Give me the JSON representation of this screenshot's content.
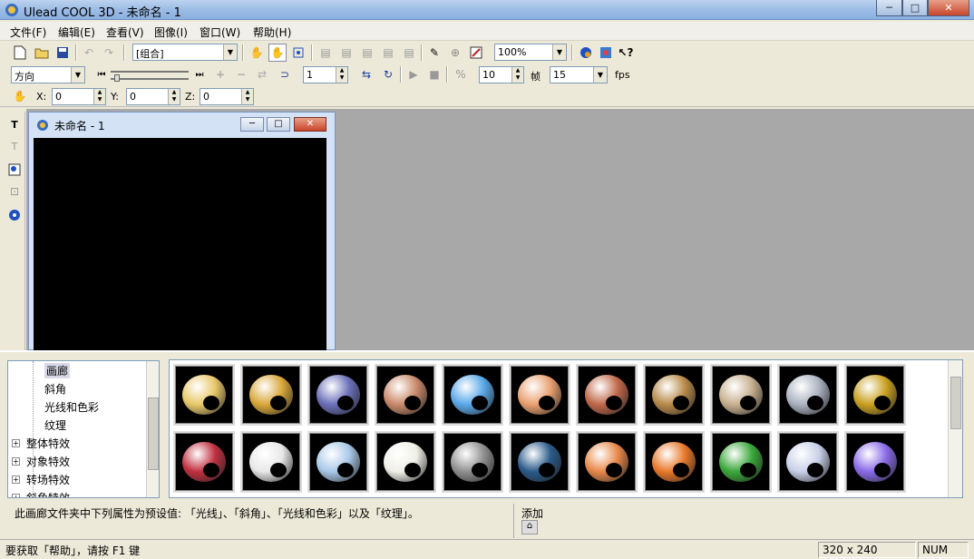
{
  "window": {
    "title": "Ulead COOL 3D - 未命名 - 1",
    "minimize": "─",
    "maximize": "□",
    "close": "✕"
  },
  "menu": [
    {
      "label": "文件(F)"
    },
    {
      "label": "编辑(E)"
    },
    {
      "label": "查看(V)"
    },
    {
      "label": "图像(I)"
    },
    {
      "label": "窗口(W)"
    },
    {
      "label": "帮助(H)"
    }
  ],
  "toolbar1": {
    "object_select": "[组合]",
    "zoom": "100%"
  },
  "toolbar2": {
    "direction": "方向",
    "frame_value": "1",
    "frames_total": "10",
    "frame_label": "帧",
    "fps_value": "15",
    "fps_label": "fps"
  },
  "toolbar3": {
    "x_label": "X:",
    "x_value": "0",
    "y_label": "Y:",
    "y_value": "0",
    "z_label": "Z:",
    "z_value": "0"
  },
  "document": {
    "title": "未命名 - 1"
  },
  "tree": [
    {
      "label": "画廊",
      "level": 2,
      "selected": true
    },
    {
      "label": "斜角",
      "level": 2
    },
    {
      "label": "光线和色彩",
      "level": 2
    },
    {
      "label": "纹理",
      "level": 2
    },
    {
      "label": "整体特效",
      "level": 1
    },
    {
      "label": "对象特效",
      "level": 1
    },
    {
      "label": "转场特效",
      "level": 1
    },
    {
      "label": "斜角特效",
      "level": 1
    }
  ],
  "gallery_colors": [
    [
      "#e8c869",
      "#d9a73a",
      "#6a6fb8",
      "#c98a6a",
      "#5aa8e8",
      "#e9a070",
      "#c0684a",
      "#b88a4a",
      "#c8b090",
      "#aab2c0",
      "#c9a020"
    ],
    [
      "#c03040",
      "#e8e8e8",
      "#a8c8e8",
      "#f0f0e8",
      "#909090",
      "#2a5a8a",
      "#e8884a",
      "#e8782a",
      "#3aa83a",
      "#c8d0e8",
      "#8a6ae8"
    ]
  ],
  "description": "此画廊文件夹中下列属性为预设值: 「光线」、「斜角」、「光线和色彩」以及「纹理」。",
  "add_label": "添加",
  "status": {
    "help": "要获取「帮助」，请按 F1 键",
    "size": "320 x 240",
    "num": "NUM"
  }
}
